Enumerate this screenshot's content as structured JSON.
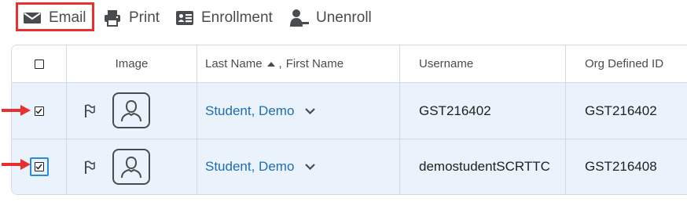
{
  "toolbar": {
    "email_label": "Email",
    "print_label": "Print",
    "enrollment_label": "Enrollment",
    "unenroll_label": "Unenroll"
  },
  "table": {
    "columns": {
      "image": "Image",
      "last_name": "Last Name",
      "separator": ",",
      "first_name": "First Name",
      "username": "Username",
      "org_id": "Org Defined ID"
    },
    "rows": [
      {
        "name": "Student, Demo",
        "username": "GST216402",
        "org_id": "GST216402",
        "checked": true
      },
      {
        "name": "Student, Demo",
        "username": "demostudentSCRTTC",
        "org_id": "GST216408",
        "checked": true
      }
    ]
  },
  "colors": {
    "highlight_red": "#e8302e",
    "link_blue": "#1e6cb1",
    "selected_row": "#eaf3fb",
    "focus_blue": "#2b8ad6"
  },
  "icons": [
    "email-icon",
    "print-icon",
    "enrollment-icon",
    "unenroll-icon",
    "flag-icon",
    "avatar-icon",
    "chevron-down-icon",
    "sort-up-icon"
  ]
}
